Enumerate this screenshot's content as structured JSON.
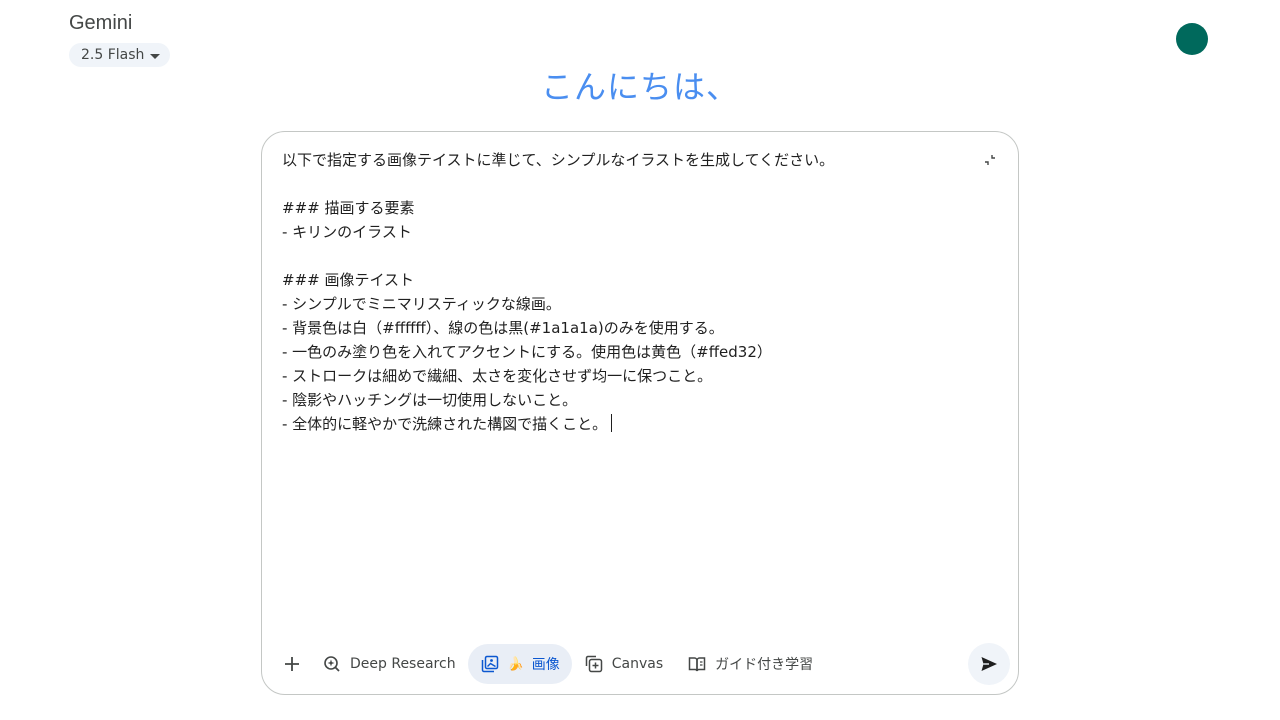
{
  "header": {
    "app_title": "Gemini",
    "model_label": "2.5 Flash"
  },
  "avatar": {
    "color": "#00695c"
  },
  "greeting": "こんにちは、",
  "composer": {
    "lines": [
      "以下で指定する画像テイストに準じて、シンプルなイラストを生成してください。",
      "",
      "### 描画する要素",
      "- キリンのイラスト",
      "",
      "### 画像テイスト",
      "- シンプルでミニマリスティックな線画。",
      "- 背景色は白（#ffffff）、線の色は黒(#1a1a1a)のみを使用する。",
      "- 一色のみ塗り色を入れてアクセントにする。使用色は黄色（#ffed32）",
      "- ストロークは細めで繊細、太さを変化させず均一に保つこと。",
      "- 陰影やハッチングは一切使用しないこと。",
      "- 全体的に軽やかで洗練された構図で描くこと。"
    ]
  },
  "toolbar": {
    "add_icon": "plus-icon",
    "deep_research_label": "Deep Research",
    "image_emoji": "🍌",
    "image_label": "画像",
    "canvas_label": "Canvas",
    "guided_learning_label": "ガイド付き学習",
    "send_icon": "send-icon"
  },
  "colors": {
    "accent": "#0b57d0",
    "greeting": "#4a8ef0",
    "chip_bg": "#f0f4f9"
  }
}
